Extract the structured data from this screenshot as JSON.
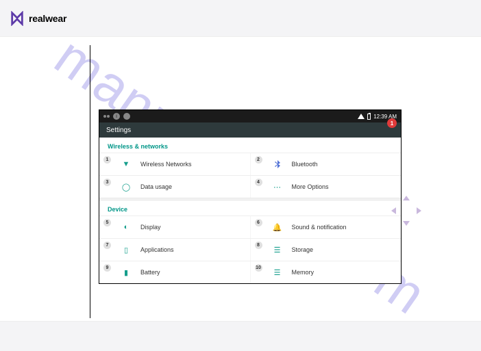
{
  "brand": {
    "name": "realwear"
  },
  "watermark": "manualshive.com",
  "status": {
    "time": "12:39 AM"
  },
  "screen": {
    "title": "Settings",
    "badge": "1"
  },
  "sections": {
    "networks": {
      "header": "Wireless & networks",
      "items": [
        {
          "num": "1",
          "label": "Wireless Networks"
        },
        {
          "num": "2",
          "label": "Bluetooth"
        },
        {
          "num": "3",
          "label": "Data usage"
        },
        {
          "num": "4",
          "label": "More Options"
        }
      ]
    },
    "device": {
      "header": "Device",
      "items": [
        {
          "num": "5",
          "label": "Display"
        },
        {
          "num": "6",
          "label": "Sound & notification"
        },
        {
          "num": "7",
          "label": "Applications"
        },
        {
          "num": "8",
          "label": "Storage"
        },
        {
          "num": "9",
          "label": "Battery"
        },
        {
          "num": "10",
          "label": "Memory"
        }
      ]
    }
  }
}
